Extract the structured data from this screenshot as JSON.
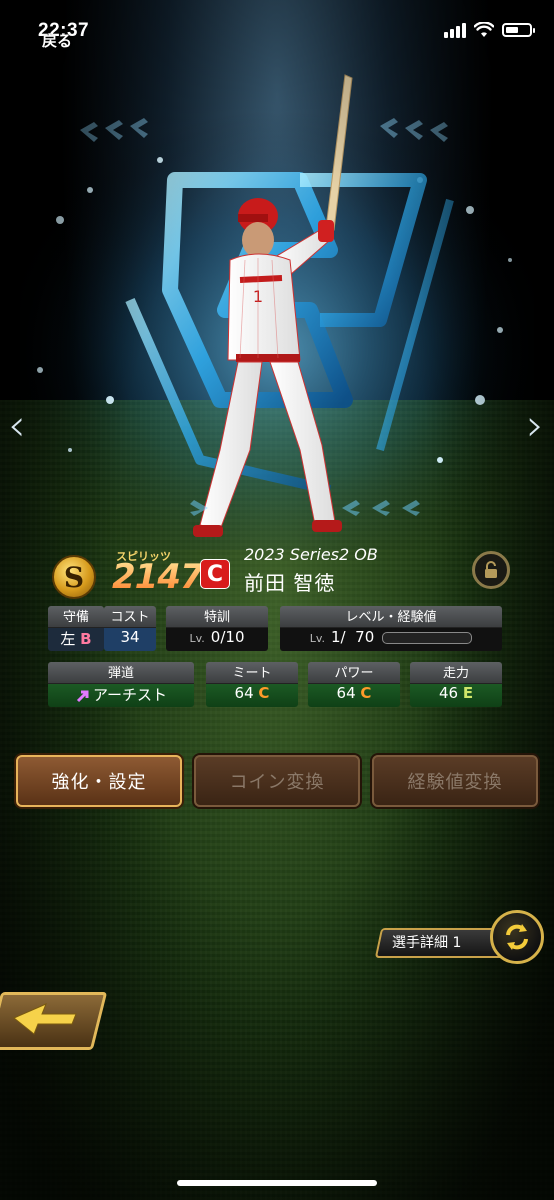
{
  "status_bar": {
    "time": "22:37"
  },
  "nav": {
    "prev": "‹",
    "next": "›"
  },
  "card": {
    "spirits_label": "スピリッツ",
    "spirits_value": "2147",
    "spirits_badge": "S",
    "team_logo": "C",
    "series": "2023 Series2 OB",
    "player_name": "前田 智徳",
    "jersey_number": "1"
  },
  "stats": {
    "defense": {
      "label": "守備",
      "hand": "左",
      "grade": "B"
    },
    "cost": {
      "label": "コスト",
      "value": "34"
    },
    "special_training": {
      "label": "特訓",
      "lv": "Lv.",
      "value": "0/10"
    },
    "level": {
      "label": "レベル・経験値",
      "lv": "Lv.",
      "value": "1/  70",
      "progress": 0
    },
    "trajectory": {
      "label": "弾道",
      "value": "アーチスト"
    },
    "meet": {
      "label": "ミート",
      "value": "64",
      "grade": "C"
    },
    "power": {
      "label": "パワー",
      "value": "64",
      "grade": "C"
    },
    "speed": {
      "label": "走力",
      "value": "46",
      "grade": "E"
    }
  },
  "buttons": {
    "enhance": "強化・設定",
    "coin_exchange": "コイン変換",
    "exp_exchange": "経験値変換"
  },
  "detail": {
    "label": "選手詳細 1"
  },
  "back": {
    "label": "戻る"
  },
  "colors": {
    "accent_gold": "#e2b85a",
    "team_red": "#d81c1c"
  }
}
